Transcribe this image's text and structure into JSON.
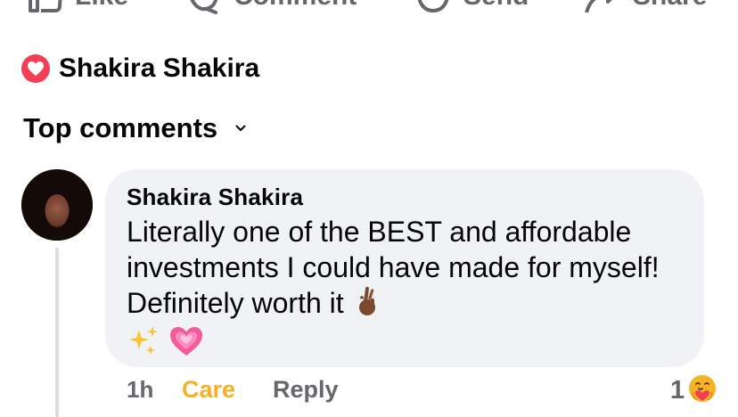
{
  "actions": [
    {
      "label": "Like",
      "icon": "like-icon"
    },
    {
      "label": "Comment",
      "icon": "comment-icon"
    },
    {
      "label": "Send",
      "icon": "send-icon"
    },
    {
      "label": "Share",
      "icon": "share-icon"
    }
  ],
  "reaction_line": {
    "icon": "love-reaction-icon",
    "name": "Shakira Shakira"
  },
  "sort": {
    "label": "Top comments",
    "icon": "chevron-down-icon"
  },
  "comment": {
    "author": "Shakira Shakira",
    "text": "Literally one of the BEST and affordable investments I could have made for myself! Definitely worth it",
    "emojis": [
      "crossed-fingers-emoji",
      "sparkles-emoji",
      "growing-heart-emoji"
    ],
    "time": "1h",
    "reaction_label": "Care",
    "reply_label": "Reply",
    "reaction_count": "1",
    "reaction_icon": "care-reaction-icon"
  },
  "colors": {
    "care": "#f7b125",
    "secondary_text": "#65676b",
    "bubble": "#f0f2f5",
    "love": "#f33e58"
  }
}
